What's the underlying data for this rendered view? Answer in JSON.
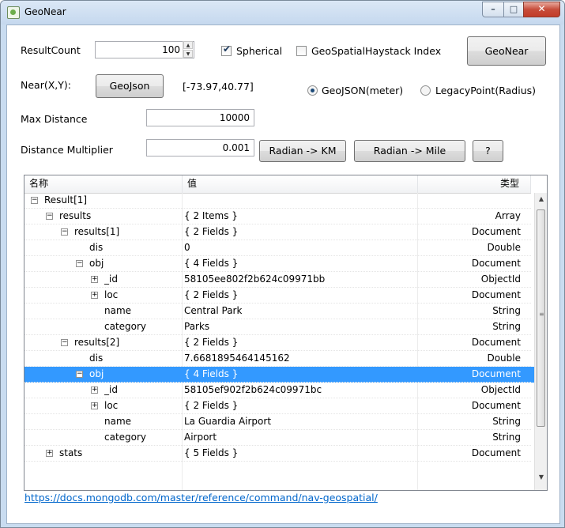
{
  "window": {
    "title": "GeoNear",
    "min_glyph": "–",
    "max_glyph": "□",
    "close_glyph": "✕"
  },
  "form": {
    "result_count_label": "ResultCount",
    "result_count_value": "100",
    "spherical_label": "Spherical",
    "spherical_checked": true,
    "haystack_label": "GeoSpatialHaystack Index",
    "haystack_checked": false,
    "geonear_button": "GeoNear",
    "near_label": "Near(X,Y):",
    "geojson_button": "GeoJson",
    "near_value": "[-73.97,40.77]",
    "radio_geojson_label": "GeoJSON(meter)",
    "radio_legacy_label": "LegacyPoint(Radius)",
    "selected_radio": "geojson",
    "max_distance_label": "Max Distance",
    "max_distance_value": "10000",
    "distance_multiplier_label": "Distance Multiplier",
    "distance_multiplier_value": "0.001",
    "radian_km_button": "Radian -> KM",
    "radian_mile_button": "Radian -> Mile",
    "help_button": "?"
  },
  "tree": {
    "columns": [
      "名称",
      "值",
      "类型"
    ],
    "rows": [
      {
        "name": "Result[1]",
        "value": "",
        "type": "",
        "level": 0,
        "expander": "minus"
      },
      {
        "name": "results",
        "value": "{ 2 Items }",
        "type": "Array",
        "level": 1,
        "expander": "minus"
      },
      {
        "name": "results[1]",
        "value": "{ 2 Fields }",
        "type": "Document",
        "level": 2,
        "expander": "minus"
      },
      {
        "name": "dis",
        "value": "0",
        "type": "Double",
        "level": 3,
        "expander": "none"
      },
      {
        "name": "obj",
        "value": "{ 4 Fields }",
        "type": "Document",
        "level": 3,
        "expander": "minus"
      },
      {
        "name": "_id",
        "value": "58105ee802f2b624c09971bb",
        "type": "ObjectId",
        "level": 4,
        "expander": "plus"
      },
      {
        "name": "loc",
        "value": "{ 2 Fields }",
        "type": "Document",
        "level": 4,
        "expander": "plus"
      },
      {
        "name": "name",
        "value": "Central Park",
        "type": "String",
        "level": 4,
        "expander": "none"
      },
      {
        "name": "category",
        "value": "Parks",
        "type": "String",
        "level": 4,
        "expander": "none"
      },
      {
        "name": "results[2]",
        "value": "{ 2 Fields }",
        "type": "Document",
        "level": 2,
        "expander": "minus"
      },
      {
        "name": "dis",
        "value": "7.6681895464145162",
        "type": "Double",
        "level": 3,
        "expander": "none"
      },
      {
        "name": "obj",
        "value": "{ 4 Fields }",
        "type": "Document",
        "level": 3,
        "expander": "minus",
        "selected": true
      },
      {
        "name": "_id",
        "value": "58105ef902f2b624c09971bc",
        "type": "ObjectId",
        "level": 4,
        "expander": "plus"
      },
      {
        "name": "loc",
        "value": "{ 2 Fields }",
        "type": "Document",
        "level": 4,
        "expander": "plus"
      },
      {
        "name": "name",
        "value": "La Guardia Airport",
        "type": "String",
        "level": 4,
        "expander": "none"
      },
      {
        "name": "category",
        "value": "Airport",
        "type": "String",
        "level": 4,
        "expander": "none"
      },
      {
        "name": "stats",
        "value": "{ 5 Fields }",
        "type": "Document",
        "level": 1,
        "expander": "plus"
      }
    ]
  },
  "footer_link": "https://docs.mongodb.com/master/reference/command/nav-geospatial/"
}
